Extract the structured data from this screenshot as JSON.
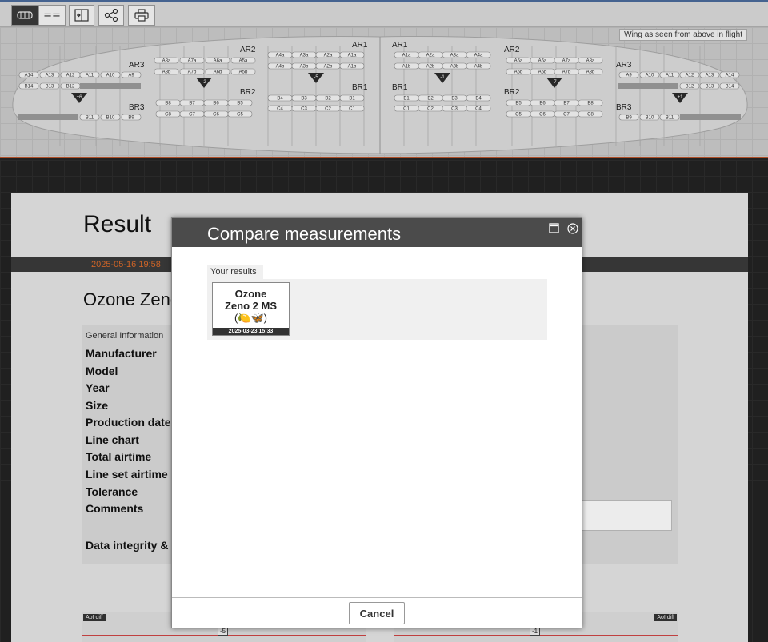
{
  "toolbar": {
    "buttons": [
      {
        "name": "wing-view-button",
        "icon": "wing-icon",
        "glyph": "▦",
        "active": true
      },
      {
        "name": "compare-view-button",
        "icon": "equals-icon",
        "glyph": "==",
        "active": false
      },
      {
        "name": "import-button",
        "icon": "import-icon"
      },
      {
        "name": "share-button",
        "icon": "share-icon"
      },
      {
        "name": "print-button",
        "icon": "print-icon"
      }
    ]
  },
  "wing": {
    "caption": "Wing as seen from above in flight",
    "left": {
      "ar3": "AR3",
      "ar2": "AR2",
      "ar1": "AR1",
      "br1": "BR1",
      "br2": "BR2",
      "br3": "BR3",
      "a_outer_top": [
        "A14",
        "A13",
        "A12",
        "A11",
        "A10",
        "A9"
      ],
      "a_outer_bottom": [
        "B14",
        "B13",
        "B12"
      ],
      "ar2_top": [
        "A8a",
        "A7a",
        "A6a",
        "A5a"
      ],
      "ar2_bottom": [
        "A8b",
        "A7b",
        "A6b",
        "A5b"
      ],
      "ar1_top": [
        "A4a",
        "A3a",
        "A2a",
        "A1a"
      ],
      "ar1_bottom": [
        "A4b",
        "A3b",
        "A2b",
        "A1b"
      ],
      "br2_b": [
        "B8",
        "B7",
        "B6",
        "B5"
      ],
      "br2_c": [
        "C8",
        "C7",
        "C6",
        "C5"
      ],
      "br1_b": [
        "B4",
        "B3",
        "B2",
        "B1"
      ],
      "br1_c": [
        "C4",
        "C3",
        "C2",
        "C1"
      ],
      "br3_b": [
        "B11",
        "B10",
        "B9"
      ],
      "markers": [
        "+6",
        "-2",
        "-5"
      ]
    },
    "right": {
      "ar3": "AR3",
      "ar2": "AR2",
      "ar1": "AR1",
      "br1": "BR1",
      "br2": "BR2",
      "br3": "BR3",
      "ar1_top": [
        "A1a",
        "A2a",
        "A3a",
        "A4a"
      ],
      "ar1_bottom": [
        "A1b",
        "A2b",
        "A3b",
        "A4b"
      ],
      "ar2_top": [
        "A5a",
        "A6a",
        "A7a",
        "A8a"
      ],
      "ar2_bottom": [
        "A5b",
        "A6b",
        "A7b",
        "A8b"
      ],
      "a_outer_top": [
        "A9",
        "A10",
        "A11",
        "A12",
        "A13",
        "A14"
      ],
      "a_outer_bottom": [
        "B12",
        "B13",
        "B14"
      ],
      "br1_b": [
        "B1",
        "B2",
        "B3",
        "B4"
      ],
      "br1_c": [
        "C1",
        "C2",
        "C3",
        "C4"
      ],
      "br2_b": [
        "B5",
        "B6",
        "B7",
        "B8"
      ],
      "br2_c": [
        "C5",
        "C6",
        "C7",
        "C8"
      ],
      "br3_b": [
        "B9",
        "B10",
        "B11"
      ],
      "markers": [
        "-1",
        "-7",
        "+1"
      ]
    }
  },
  "result": {
    "title": "Result",
    "timestamp": "2025-05-16 19:58",
    "glider_name": "Ozone Zeno",
    "section_header": "General Information",
    "fields": [
      "Manufacturer",
      "Model",
      "Year",
      "Size",
      "Production date",
      "Line chart",
      "Total airtime",
      "Line set airtime",
      "Tolerance",
      "Comments"
    ],
    "integrity_label": "Data integrity &"
  },
  "charts": {
    "aoi_label": "AoI diff",
    "left_mark": "-5",
    "right_mark": "-1"
  },
  "modal": {
    "title": "Compare measurements",
    "results_label": "Your results",
    "card": {
      "name_line1": "Ozone",
      "name_line2": "Zeno 2 MS",
      "icons": "(🍋🦋)",
      "date": "2025-03-23 15:33"
    },
    "cancel_label": "Cancel"
  }
}
